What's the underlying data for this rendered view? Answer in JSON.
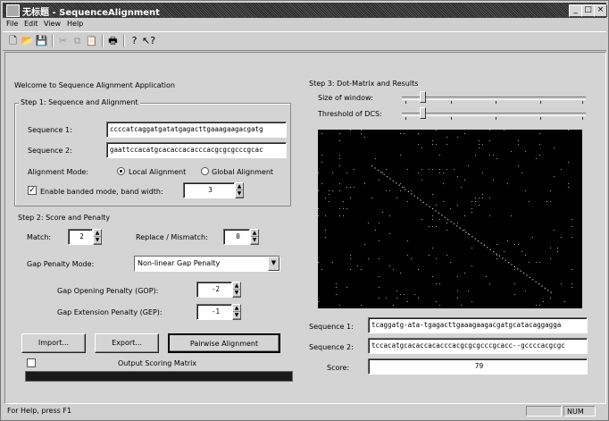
{
  "window": {
    "title": "无标题 - SequenceAlignment",
    "controls": {
      "minimize": "_",
      "maximize": "□",
      "close": "×"
    }
  },
  "menu": [
    "File",
    "Edit",
    "View",
    "Help"
  ],
  "toolbar": [
    "new-icon",
    "open-icon",
    "save-icon",
    "cut-icon",
    "copy-icon",
    "paste-icon",
    "print-icon",
    "about-icon",
    "context-help-icon"
  ],
  "main": {
    "welcome": "Welcome to Sequence Alignment Application",
    "step1": {
      "legend": "Step 1: Sequence and Alignment",
      "seq1_label": "Sequence 1:",
      "seq1_value": "ccccatcaggatgatatgagacttgaaagaagacgatg",
      "seq2_label": "Sequence 2:",
      "seq2_value": "gaattccacatgcacaccacacccacgcgcgcccgcac",
      "mode_label": "Alignment Mode:",
      "mode_local": "Local Alignment",
      "mode_global": "Global Alignment",
      "mode_selected": "local",
      "banded_label": "Enable banded mode, band width:",
      "banded_checked": true,
      "band_width": "3"
    },
    "step2": {
      "legend": "Step 2: Score and Penalty",
      "match_label": "Match:",
      "match_value": "2",
      "replace_label": "Replace / Mismatch:",
      "replace_value": "0",
      "gap_mode_label": "Gap Penalty Mode:",
      "gap_mode_value": "Non-linear Gap Penalty",
      "gop_label": "Gap Opening Penalty (GOP):",
      "gop_value": "-2",
      "gep_label": "Gap Extension Penalty (GEP):",
      "gep_value": "-1"
    },
    "buttons": {
      "import": "Import...",
      "export": "Export...",
      "pairwise": "Pairwise Alignment"
    },
    "output_label": "Output Scoring Matrix",
    "output_checked": false
  },
  "step3": {
    "legend": "Step 3: Dot-Matrix and Results",
    "window_label": "Size of window:",
    "threshold_label": "Threshold of DCS:",
    "result_seq1_label": "Sequence 1:",
    "result_seq1": "tcaggatg-ata-tgagacttgaaagaagacgatgcatacaggagga",
    "result_seq2_label": "Sequence 2:",
    "result_seq2": "tccacatgcacaccacacccacgcgcgcccgcacc--gccccacgcgc",
    "score_label": "Score:",
    "score_value": "79"
  },
  "statusbar": {
    "help": "For Help, press F1",
    "num": "NUM"
  }
}
